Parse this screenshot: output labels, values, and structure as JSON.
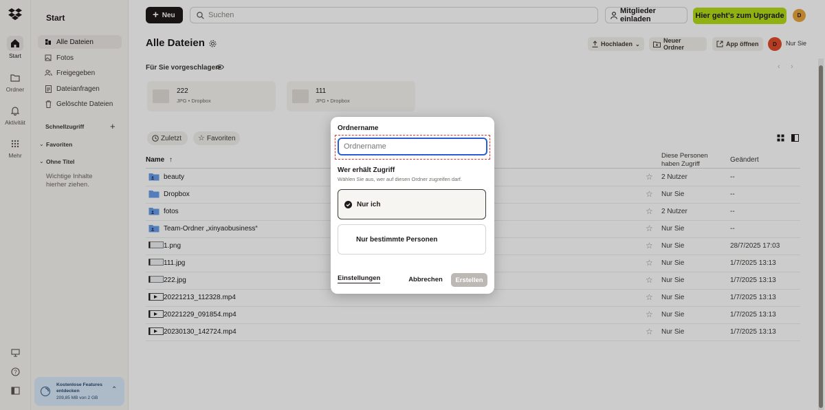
{
  "rail": {
    "items": [
      {
        "label": "Start",
        "icon": "home-icon"
      },
      {
        "label": "Ordner",
        "icon": "folder-icon"
      },
      {
        "label": "Aktivität",
        "icon": "bell-icon"
      },
      {
        "label": "Mehr",
        "icon": "grid-icon"
      }
    ],
    "bottom_icons": [
      "desktop-icon",
      "help-icon",
      "sidebar-toggle-icon"
    ]
  },
  "sidebar": {
    "title": "Start",
    "nav": [
      {
        "label": "Alle Dateien",
        "icon": "files-icon"
      },
      {
        "label": "Fotos",
        "icon": "photo-icon"
      },
      {
        "label": "Freigegeben",
        "icon": "shared-icon"
      },
      {
        "label": "Dateianfragen",
        "icon": "file-request-icon"
      },
      {
        "label": "Gelöschte Dateien",
        "icon": "trash-icon"
      }
    ],
    "quick_access": "Schnellzugriff",
    "favorites": "Favoriten",
    "untitled": "Ohne Titel",
    "drop_hint_1": "Wichtige Inhalte",
    "drop_hint_2": "hierher ziehen.",
    "upgrade": {
      "title_1": "Kostenlose Features",
      "title_2": "entdecken",
      "usage": "209,85 MB von 2 GB"
    }
  },
  "topbar": {
    "new_label": "Neu",
    "search_placeholder": "Suchen",
    "invite_label": "Mitglieder einladen",
    "upgrade_label": "Hier geht's zum Upgrade",
    "avatar_letter": "D"
  },
  "main": {
    "title": "Alle Dateien",
    "toolbar": {
      "upload": "Hochladen",
      "new_folder": "Neuer Ordner",
      "open_app": "App öffnen",
      "avatar_letter": "D",
      "only_you": "Nur Sie"
    },
    "suggested_label": "Für Sie vorgeschlagen",
    "suggested": [
      {
        "name": "222",
        "meta": "JPG • Dropbox"
      },
      {
        "name": "111",
        "meta": "JPG • Dropbox"
      }
    ],
    "filters": {
      "recent": "Zuletzt",
      "favorites": "Favoriten"
    },
    "columns": {
      "name": "Name",
      "access_1": "Diese Personen",
      "access_2": "haben Zugriff",
      "modified": "Geändert"
    },
    "rows": [
      {
        "name": "beauty",
        "icon": "shared-folder-icon",
        "access": "2 Nutzer",
        "modified": "--"
      },
      {
        "name": "Dropbox",
        "icon": "folder-icon",
        "access": "Nur Sie",
        "modified": "--"
      },
      {
        "name": "fotos",
        "icon": "shared-folder-icon",
        "access": "2 Nutzer",
        "modified": "--"
      },
      {
        "name": "Team-Ordner „xinyaobusiness“",
        "icon": "shared-folder-icon",
        "access": "Nur Sie",
        "modified": "--"
      },
      {
        "name": "1.png",
        "icon": "image-thumb-icon",
        "access": "Nur Sie",
        "modified": "28/7/2025 17:03"
      },
      {
        "name": "111.jpg",
        "icon": "image-thumb-icon",
        "access": "Nur Sie",
        "modified": "1/7/2025 13:13"
      },
      {
        "name": "222.jpg",
        "icon": "image-thumb-icon",
        "access": "Nur Sie",
        "modified": "1/7/2025 13:13"
      },
      {
        "name": "20221213_112328.mp4",
        "icon": "video-icon",
        "access": "Nur Sie",
        "modified": "1/7/2025 13:13"
      },
      {
        "name": "20221229_091854.mp4",
        "icon": "video-icon",
        "access": "Nur Sie",
        "modified": "1/7/2025 13:13"
      },
      {
        "name": "20230130_142724.mp4",
        "icon": "video-icon",
        "access": "Nur Sie",
        "modified": "1/7/2025 13:13"
      }
    ]
  },
  "modal": {
    "folder_name_label": "Ordnername",
    "folder_name_placeholder": "Ordnername",
    "folder_name_value": "",
    "access_title": "Wer erhält Zugriff",
    "access_subtitle": "Wählen Sie aus, wer auf diesen Ordner zugreifen darf.",
    "options": [
      {
        "label": "Nur ich",
        "selected": true
      },
      {
        "label": "Nur bestimmte Personen",
        "selected": false
      }
    ],
    "settings_link": "Einstellungen",
    "cancel": "Abbrechen",
    "create": "Erstellen"
  },
  "colors": {
    "accent_blue": "#0061fe",
    "upgrade_green": "#b4dc19",
    "avatar_orange": "#e8a43b",
    "avatar_red": "#e34c28",
    "highlight_red": "#e0362a"
  }
}
